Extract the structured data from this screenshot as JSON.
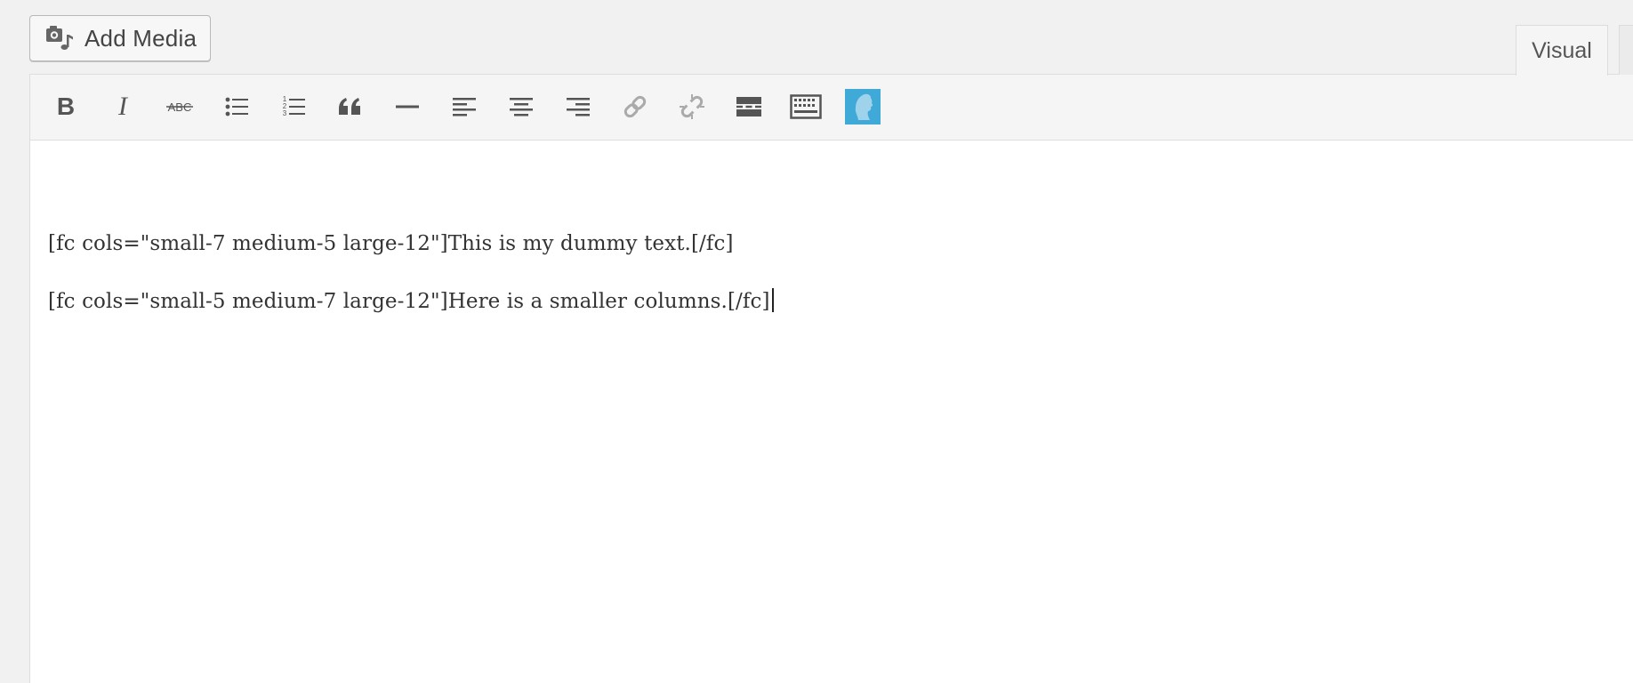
{
  "toolbar_top": {
    "add_media_label": "Add Media",
    "add_media_icon": "media-camera-music-icon"
  },
  "tabs": [
    {
      "label": "Visual",
      "active": true
    }
  ],
  "format_toolbar": {
    "buttons": [
      {
        "name": "bold-icon"
      },
      {
        "name": "italic-icon"
      },
      {
        "name": "strikethrough-icon",
        "glyph": "ABC"
      },
      {
        "name": "bulleted-list-icon"
      },
      {
        "name": "numbered-list-icon",
        "glyph": "123"
      },
      {
        "name": "blockquote-icon"
      },
      {
        "name": "horizontal-line-icon"
      },
      {
        "name": "align-left-icon"
      },
      {
        "name": "align-center-icon"
      },
      {
        "name": "align-right-icon"
      },
      {
        "name": "insert-link-icon"
      },
      {
        "name": "remove-link-icon"
      },
      {
        "name": "read-more-icon"
      },
      {
        "name": "toolbar-toggle-icon"
      },
      {
        "name": "plugin-shortcode-icon",
        "color": "#3fa9d8"
      }
    ]
  },
  "editor": {
    "paragraphs": [
      "[fc cols=\"small-7 medium-5 large-12\"]This is my dummy text.[/fc]",
      "[fc cols=\"small-5 medium-7 large-12\"]Here is a smaller columns.[/fc]"
    ]
  },
  "colors": {
    "page_bg": "#f1f1f1",
    "toolbar_bg": "#f5f5f5",
    "icon_gray": "#555555",
    "icon_disabled": "#a9a9a9",
    "plugin_blue": "#3fa9d8"
  }
}
